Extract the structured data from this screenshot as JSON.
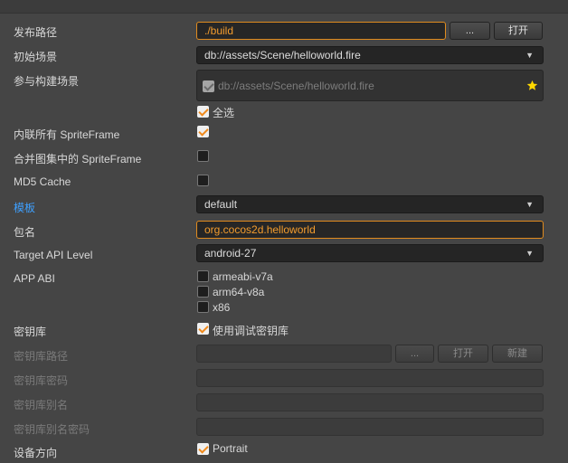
{
  "publish_path": {
    "label": "发布路径",
    "value": "./build",
    "browse_label": "...",
    "open_label": "打开"
  },
  "start_scene": {
    "label": "初始场景",
    "value": "db://assets/Scene/helloworld.fire"
  },
  "build_scenes": {
    "label": "参与构建场景",
    "items": [
      {
        "path": "db://assets/Scene/helloworld.fire",
        "checked": true,
        "is_start": true
      }
    ],
    "select_all_label": "全选"
  },
  "inline_spriteframe": {
    "label": "内联所有 SpriteFrame",
    "checked": true
  },
  "merge_spriteframe": {
    "label": "合并图集中的 SpriteFrame",
    "checked": false
  },
  "md5_cache": {
    "label": "MD5 Cache",
    "checked": false
  },
  "template": {
    "label": "模板",
    "value": "default"
  },
  "package_name": {
    "label": "包名",
    "value": "org.cocos2d.helloworld"
  },
  "target_api": {
    "label": "Target API Level",
    "value": "android-27"
  },
  "app_abi": {
    "label": "APP ABI",
    "options": [
      {
        "name": "armeabi-v7a",
        "checked": false
      },
      {
        "name": "arm64-v8a",
        "checked": false
      },
      {
        "name": "x86",
        "checked": false
      }
    ]
  },
  "keystore": {
    "label": "密钥库",
    "use_debug_label": "使用调试密钥库",
    "use_debug_checked": true
  },
  "keystore_path": {
    "label": "密钥库路径",
    "browse_label": "...",
    "open_label": "打开",
    "new_label": "新建"
  },
  "keystore_password": {
    "label": "密钥库密码"
  },
  "keystore_alias": {
    "label": "密钥库别名"
  },
  "keystore_alias_password": {
    "label": "密钥库别名密码"
  },
  "orientation": {
    "label": "设备方向",
    "portrait_label": "Portrait",
    "portrait_checked": true
  },
  "colors": {
    "accent": "#f39c2d",
    "link_blue": "#3ea0ff",
    "star": "#ffd800"
  }
}
